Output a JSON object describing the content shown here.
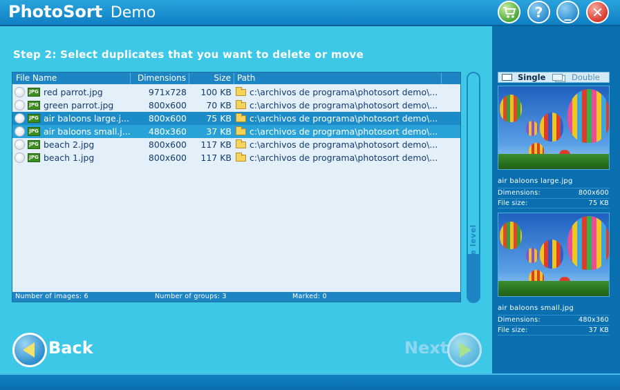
{
  "window": {
    "app_name": "PhotoSort",
    "app_edition": "Demo",
    "help_glyph": "?",
    "minimize_glyph": "_",
    "close_glyph": "✕",
    "icons": [
      "cart-icon",
      "help-icon",
      "minimize-icon",
      "close-icon"
    ]
  },
  "step": {
    "title": "Step 2:  Select duplicates that you want to delete or move"
  },
  "table": {
    "columns": [
      "File Name",
      "Dimensions",
      "Size",
      "Path"
    ],
    "rows": [
      {
        "name": "red parrot.jpg",
        "dimensions": "971x728",
        "size": "100 KB",
        "path": "c:\\archivos de programa\\photosort demo\\...",
        "state": "normal"
      },
      {
        "name": "green parrot.jpg",
        "dimensions": "800x600",
        "size": "70 KB",
        "path": "c:\\archivos de programa\\photosort demo\\...",
        "state": "normal"
      },
      {
        "name": "air baloons large.j...",
        "dimensions": "800x600",
        "size": "75 KB",
        "path": "c:\\archivos de programa\\photosort demo\\...",
        "state": "selected"
      },
      {
        "name": "air baloons small.j...",
        "dimensions": "480x360",
        "size": "37 KB",
        "path": "c:\\archivos de programa\\photosort demo\\...",
        "state": "selected-secondary"
      },
      {
        "name": "beach 2.jpg",
        "dimensions": "800x600",
        "size": "117 KB",
        "path": "c:\\archivos de programa\\photosort demo\\...",
        "state": "normal"
      },
      {
        "name": "beach 1.jpg",
        "dimensions": "800x600",
        "size": "117 KB",
        "path": "c:\\archivos de programa\\photosort demo\\...",
        "state": "normal"
      }
    ],
    "file_badge": "JPG"
  },
  "status": {
    "images": "Number of images: 6",
    "groups": "Number of groups: 3",
    "marked": "Marked:  0"
  },
  "tolerance": {
    "label": "tolerance level",
    "level_fraction": 0.21
  },
  "nav": {
    "back_label": "Back",
    "next_label": "Next"
  },
  "preview": {
    "view_single": "Single",
    "view_double": "Double",
    "items": [
      {
        "file": "air baloons large.jpg",
        "dim_label": "Dimensions:",
        "dim_value": "800x600",
        "size_label": "File size:",
        "size_value": "75 KB"
      },
      {
        "file": "air baloons small.jpg",
        "dim_label": "Dimensions:",
        "dim_value": "480x360",
        "size_label": "File size:",
        "size_value": "37 KB"
      }
    ]
  },
  "colors": {
    "panel": "#3ec8e7",
    "header": "#1e85c4",
    "selection": "#1b8cc8",
    "sidebar": "#0a6fae"
  }
}
